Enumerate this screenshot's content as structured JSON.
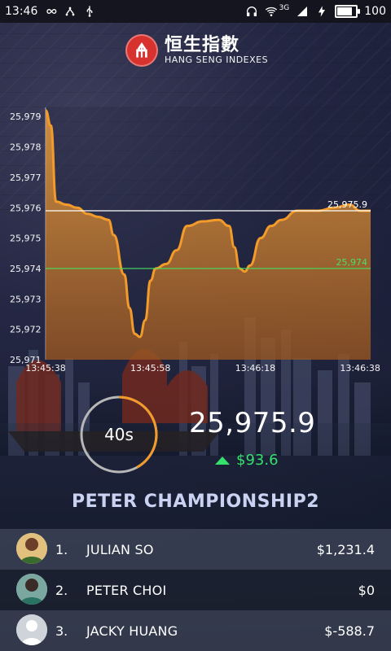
{
  "status_bar": {
    "time": "13:46",
    "battery": "100",
    "battery_level": 1.0,
    "network": "3G",
    "icons": [
      "infinity-icon",
      "usb-icon",
      "bluetooth-icon",
      "headphones-icon",
      "wifi-icon",
      "signal-icon",
      "charging-icon",
      "battery-icon"
    ]
  },
  "header": {
    "brand_cn": "恒生指數",
    "brand_en": "HANG SENG INDEXES",
    "logo_color": "#d8322f"
  },
  "chart_data": {
    "type": "area",
    "title": "",
    "xlabel": "",
    "ylabel": "",
    "ylim": [
      25971,
      25979.3
    ],
    "xlim": [
      0,
      62
    ],
    "y_ticks": [
      "25,979",
      "25,978",
      "25,977",
      "25,976",
      "25,975",
      "25,974",
      "25,973",
      "25,972",
      "25,971"
    ],
    "x_ticks": [
      {
        "x": 0,
        "label": "13:45:38"
      },
      {
        "x": 20,
        "label": "13:45:58"
      },
      {
        "x": 40,
        "label": "13:46:18"
      },
      {
        "x": 60,
        "label": "13:46:38"
      }
    ],
    "series": [
      {
        "name": "",
        "values": [
          [
            0,
            25979.2
          ],
          [
            1,
            25978.7
          ],
          [
            2,
            25976.2
          ],
          [
            4,
            25976.1
          ],
          [
            6,
            25976.0
          ],
          [
            8,
            25975.8
          ],
          [
            10,
            25975.7
          ],
          [
            12,
            25975.6
          ],
          [
            13,
            25975.1
          ],
          [
            15,
            25973.8
          ],
          [
            16,
            25972.7
          ],
          [
            17,
            25971.85
          ],
          [
            18,
            25971.75
          ],
          [
            19,
            25972.3
          ],
          [
            20,
            25973.6
          ],
          [
            21,
            25974.0
          ],
          [
            23,
            25974.15
          ],
          [
            25,
            25974.6
          ],
          [
            27,
            25975.4
          ],
          [
            30,
            25975.55
          ],
          [
            33,
            25975.6
          ],
          [
            35,
            25975.4
          ],
          [
            36,
            25974.7
          ],
          [
            37,
            25974.0
          ],
          [
            38,
            25973.9
          ],
          [
            39,
            25974.1
          ],
          [
            41,
            25975.0
          ],
          [
            43,
            25975.4
          ],
          [
            45,
            25975.6
          ],
          [
            48,
            25975.9
          ],
          [
            52,
            25975.9
          ],
          [
            55,
            25976.0
          ],
          [
            58,
            25976.1
          ],
          [
            60,
            25975.9
          ],
          [
            62,
            25975.9
          ]
        ]
      }
    ],
    "reference_lines": [
      {
        "y": 25975.9,
        "label": "25,975.9",
        "color": "#ffffff"
      },
      {
        "y": 25974.0,
        "label": "25,974",
        "color": "#48e05f"
      }
    ],
    "colors": {
      "line": "#f29b2a",
      "fill_top": "#f2a43f",
      "fill_bottom": "#a35a1f"
    }
  },
  "timer": {
    "text": "40s",
    "progress": 0.42,
    "ring_color": "#f29b2a",
    "track_color": "#b7b7b7"
  },
  "quote": {
    "value": "25,975.9",
    "change": "$93.6",
    "change_color": "#35e06d"
  },
  "leaderboard": {
    "title": "PETER CHAMPIONSHIP2",
    "rows": [
      {
        "rank": "1.",
        "name": "JULIAN SO",
        "amount": "$1,231.4",
        "avatar_icon": "avatar-icon"
      },
      {
        "rank": "2.",
        "name": "PETER CHOI",
        "amount": "$0",
        "avatar_icon": "avatar-icon"
      },
      {
        "rank": "3.",
        "name": "JACKY HUANG",
        "amount": "$-588.7",
        "avatar_icon": "avatar-icon"
      }
    ]
  }
}
